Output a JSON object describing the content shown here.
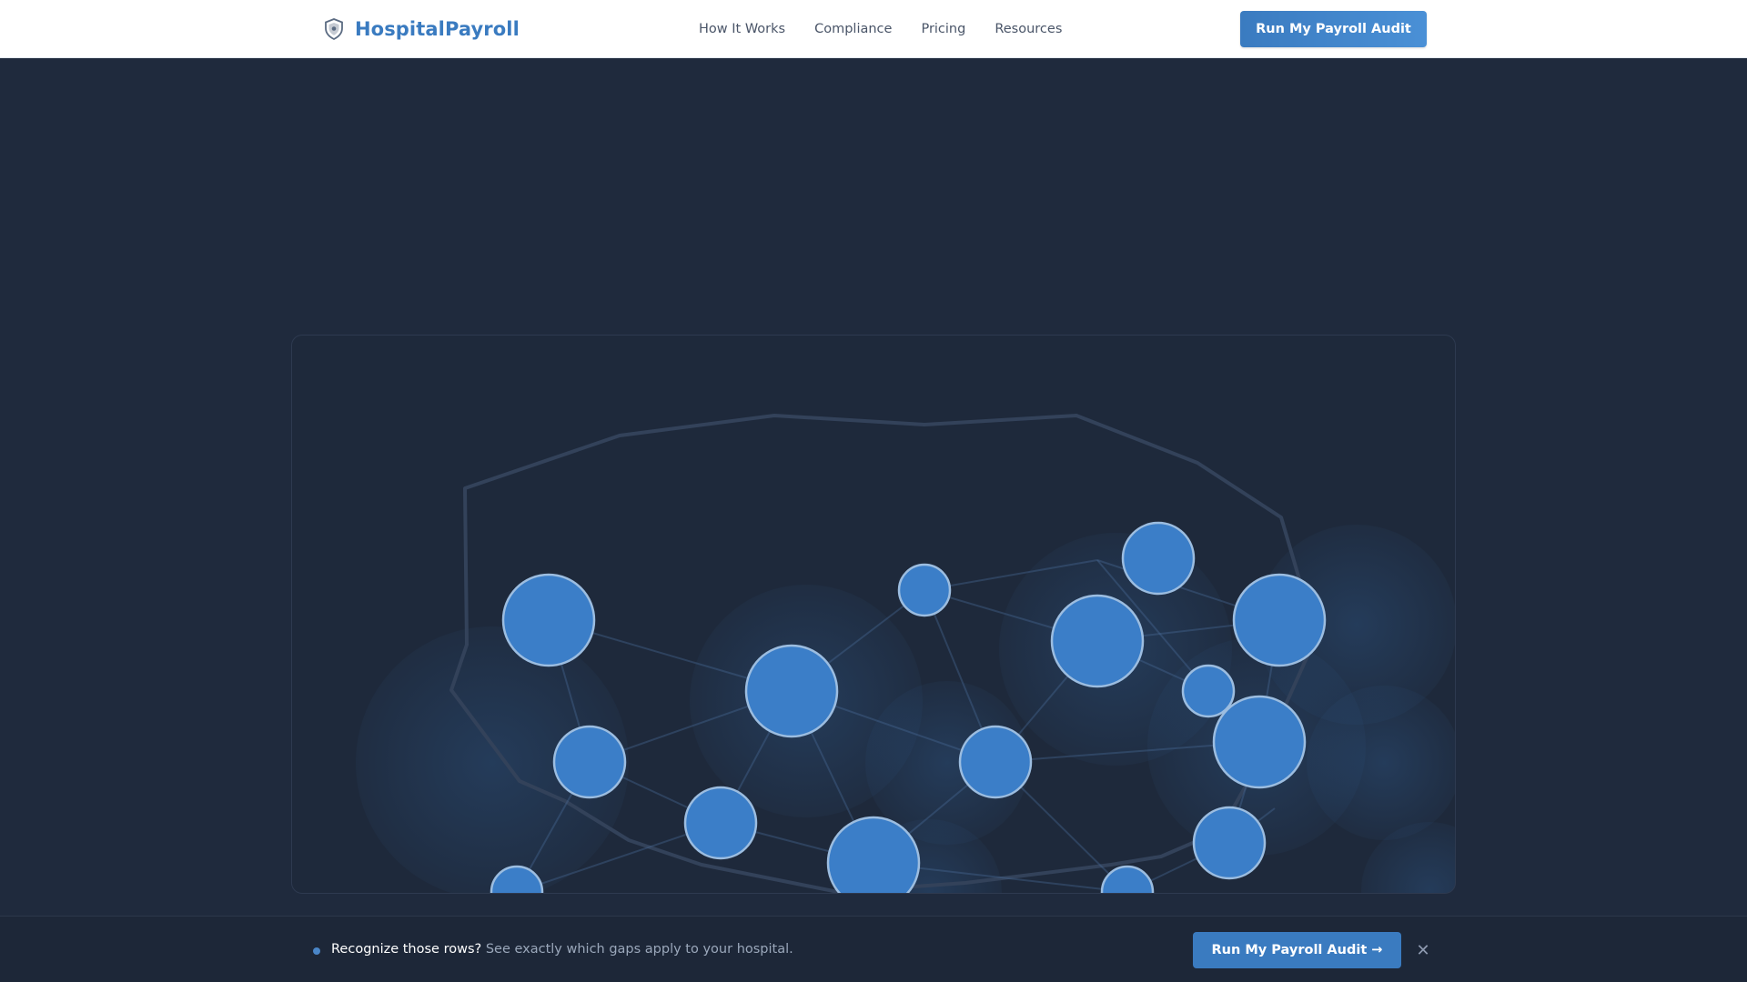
{
  "nav": {
    "brand": "HospitalPayroll",
    "brand_icon": "shield-icon",
    "links": [
      "How It Works",
      "Compliance",
      "Pricing",
      "Resources"
    ],
    "cta_label": "Run My Payroll Audit"
  },
  "hero": {
    "visual_icon": "network-graph-map"
  },
  "sticky_bar": {
    "headline": "Recognize those rows?",
    "subtext": " See exactly which gaps apply to your hospital.",
    "cta_label": "Run My Payroll Audit →",
    "close_icon": "close-icon",
    "close_glyph": "✕"
  },
  "colors": {
    "brand": "#3a7bc0",
    "background": "#1f2a3d",
    "node": "#3b7ec8"
  }
}
